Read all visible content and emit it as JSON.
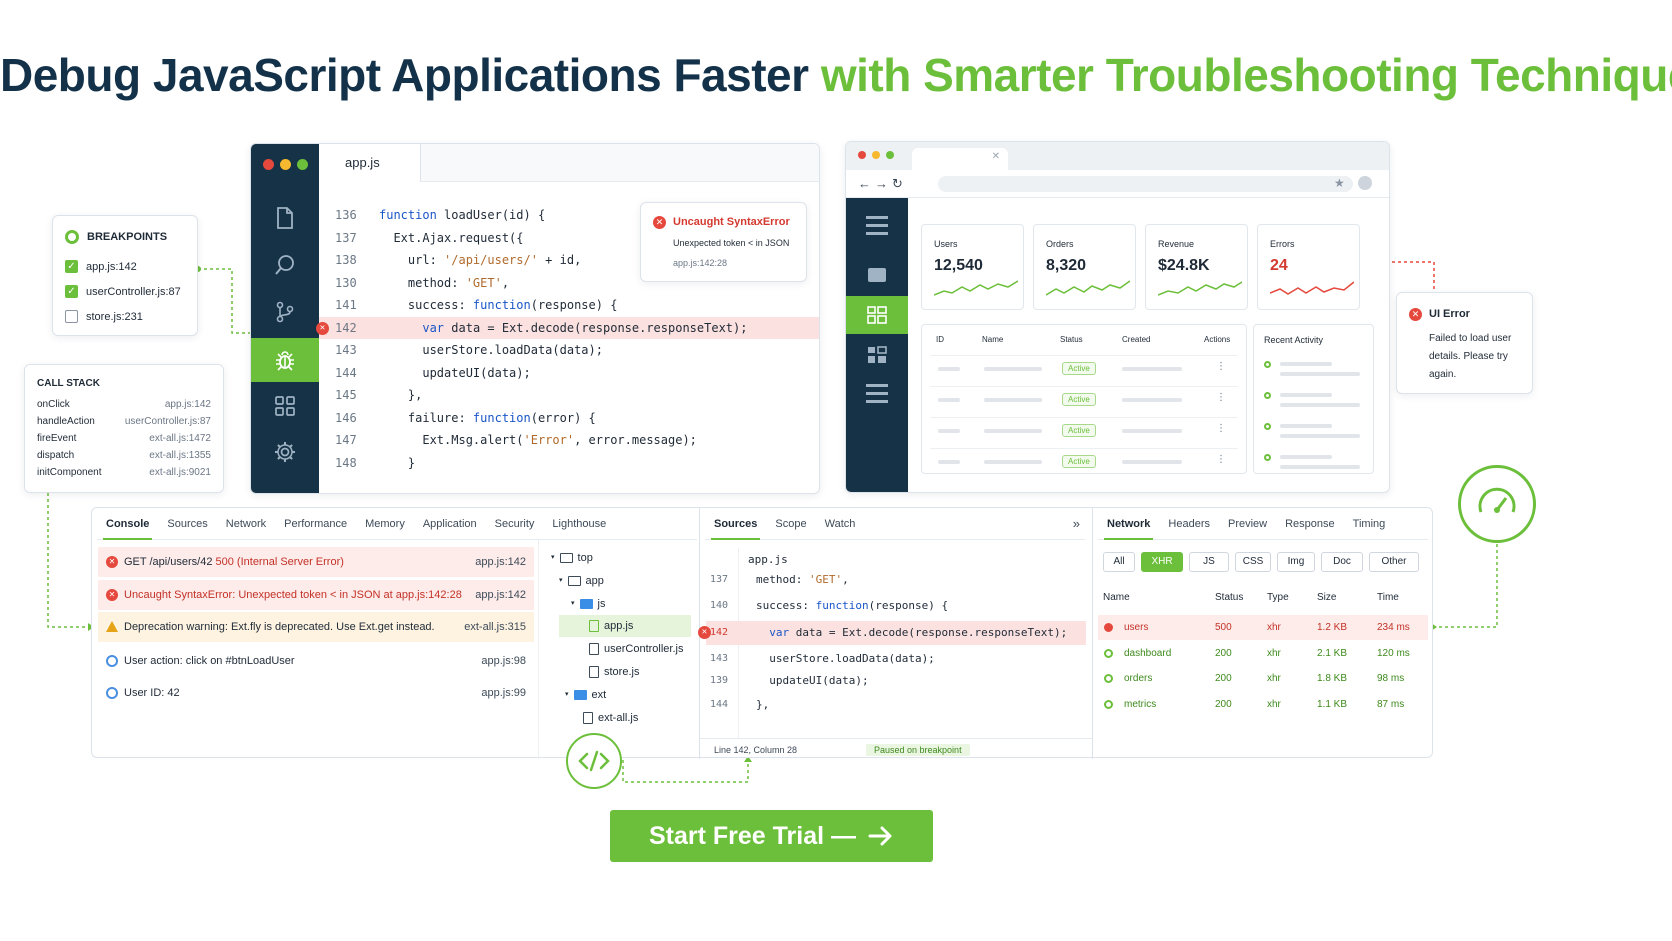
{
  "headline": {
    "part1": "Debug JavaScript Applications Faster",
    "part2": "with Smarter Troubleshooting Techniques"
  },
  "colors": {
    "navy": "#163246",
    "green": "#6cbf3a",
    "red": "#e5483d",
    "text": "#1f2a37"
  },
  "breakpoints": {
    "title": "BREAKPOINTS",
    "items": [
      {
        "label": "app.js:142",
        "checked": true
      },
      {
        "label": "userController.js:87",
        "checked": true
      },
      {
        "label": "store.js:231",
        "checked": false
      }
    ]
  },
  "call_stack": {
    "title": "CALL STACK",
    "frames": [
      {
        "fn": "onClick",
        "loc": "app.js:142"
      },
      {
        "fn": "handleAction",
        "loc": "userController.js:87"
      },
      {
        "fn": "fireEvent",
        "loc": "ext-all.js:1472"
      },
      {
        "fn": "dispatch",
        "loc": "ext-all.js:1355"
      },
      {
        "fn": "initComponent",
        "loc": "ext-all.js:9021"
      }
    ]
  },
  "editor": {
    "tab": "app.js",
    "sidebar_icons": [
      "file-icon",
      "search-icon",
      "branch-icon",
      "bug-icon",
      "extensions-icon",
      "gear-icon"
    ],
    "lines": [
      {
        "n": "136",
        "code": "function loadUser(id) {"
      },
      {
        "n": "137",
        "code": "  Ext.Ajax.request({"
      },
      {
        "n": "138",
        "code": "    url: '/api/users/' + id,"
      },
      {
        "n": "130",
        "code": "    method: 'GET',"
      },
      {
        "n": "141",
        "code": "    success: function(response) {"
      },
      {
        "n": "142",
        "code": "      var data = Ext.decode(response.responseText);"
      },
      {
        "n": "143",
        "code": "      userStore.loadData(data);"
      },
      {
        "n": "144",
        "code": "      updateUI(data);"
      },
      {
        "n": "145",
        "code": "    },"
      },
      {
        "n": "146",
        "code": "    failure: function(error) {"
      },
      {
        "n": "147",
        "code": "      Ext.Msg.alert('Error', error.message);"
      },
      {
        "n": "148",
        "code": "    }"
      }
    ],
    "error_popup": {
      "title": "Uncaught SyntaxError",
      "message": "Unexpected token < in JSON",
      "location": "app.js:142:28"
    }
  },
  "browser": {
    "stats": [
      {
        "label": "Users",
        "value": "12,540"
      },
      {
        "label": "Orders",
        "value": "8,320"
      },
      {
        "label": "Revenue",
        "value": "$24.8K"
      },
      {
        "label": "Errors",
        "value": "24"
      }
    ],
    "table": {
      "headers": [
        "ID",
        "Name",
        "Status",
        "Created",
        "Actions"
      ],
      "rows": [
        "Active",
        "Active",
        "Active",
        "Active"
      ]
    },
    "recent_activity": "Recent Activity",
    "ui_error": {
      "title": "UI Error",
      "message": "Failed to load user details. Please try again."
    }
  },
  "console": {
    "tabs": [
      "Console",
      "Sources",
      "Network",
      "Performance",
      "Memory",
      "Application",
      "Security",
      "Lighthouse"
    ],
    "rows": [
      {
        "type": "error",
        "prefix": "GET /api/users/42 ",
        "status": "500 (Internal Server Error)",
        "source": "app.js:142"
      },
      {
        "type": "error",
        "prefix": "Uncaught SyntaxError: Unexpected token < in JSON at app.js:142:28",
        "status": "",
        "source": "app.js:142"
      },
      {
        "type": "warn",
        "prefix": "Deprecation warning: Ext.fly is deprecated. Use Ext.get instead.",
        "status": "",
        "source": "ext-all.js:315"
      },
      {
        "type": "info",
        "prefix": "User action: click on #btnLoadUser",
        "status": "",
        "source": "app.js:98"
      },
      {
        "type": "info",
        "prefix": "User ID: 42",
        "status": "",
        "source": "app.js:99"
      }
    ]
  },
  "file_tree": [
    "top",
    "app",
    "js",
    "app.js",
    "userController.js",
    "store.js",
    "ext",
    "ext-all.js"
  ],
  "sources": {
    "tabs": [
      "Sources",
      "Scope",
      "Watch"
    ],
    "file": "app.js",
    "lines": [
      {
        "n": "137",
        "code": "method: 'GET',"
      },
      {
        "n": "140",
        "code": "success: function(response) {"
      },
      {
        "n": "142",
        "code": "  var data = Ext.decode(response.responseText);"
      },
      {
        "n": "143",
        "code": "  userStore.loadData(data);"
      },
      {
        "n": "139",
        "code": "  updateUI(data);"
      },
      {
        "n": "144",
        "code": "},"
      }
    ],
    "status_left": "Line 142, Column 28",
    "status_right": "Paused on breakpoint"
  },
  "network": {
    "tabs": [
      "Network",
      "Headers",
      "Preview",
      "Response",
      "Timing"
    ],
    "filters": [
      "All",
      "XHR",
      "JS",
      "CSS",
      "Img",
      "Doc",
      "Other"
    ],
    "headers": [
      "Name",
      "Status",
      "Type",
      "Size",
      "Time"
    ],
    "rows": [
      {
        "name": "users",
        "status": "500",
        "type": "xhr",
        "size": "1.2 KB",
        "time": "234 ms"
      },
      {
        "name": "dashboard",
        "status": "200",
        "type": "xhr",
        "size": "2.1 KB",
        "time": "120 ms"
      },
      {
        "name": "orders",
        "status": "200",
        "type": "xhr",
        "size": "1.8 KB",
        "time": "98 ms"
      },
      {
        "name": "metrics",
        "status": "200",
        "type": "xhr",
        "size": "1.1 KB",
        "time": "87 ms"
      }
    ]
  },
  "cta": {
    "label": "Start Free Trial —"
  }
}
